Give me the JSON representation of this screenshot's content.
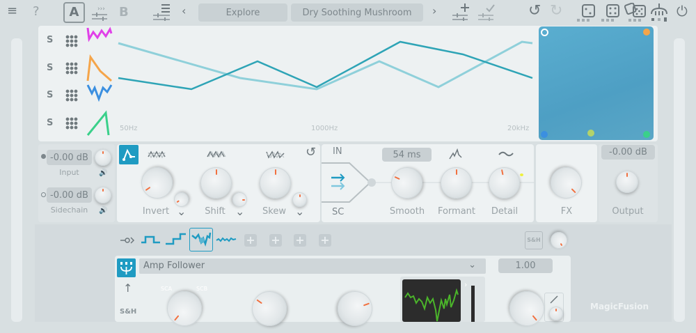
{
  "toolbar": {
    "menu": "≡",
    "help": "?",
    "a_label": "A",
    "b_label": "B",
    "prev": "‹",
    "next": "›",
    "preset_bank": "Explore",
    "preset_name": "Dry Soothing Mushroom",
    "undo": "↺",
    "redo": "↻",
    "power": "⏻"
  },
  "display": {
    "rows": [
      {
        "label": "S"
      },
      {
        "label": "S"
      },
      {
        "label": "S"
      },
      {
        "label": "S"
      }
    ],
    "freq_labels": [
      "50Hz",
      "1000Hz",
      "20kHz"
    ],
    "colors": {
      "light_line": "#8fd0da",
      "dark_line": "#2ea4b6",
      "xy_pad": "#5aaacb"
    }
  },
  "io": {
    "input_value": "-0.00 dB",
    "input_label": "Input",
    "sidechain_value": "-0.00 dB",
    "sidechain_label": "Sidechain",
    "speaker": "🔊"
  },
  "shape": {
    "knobs": [
      {
        "label": "Invert"
      },
      {
        "label": "Shift"
      },
      {
        "label": "Skew"
      }
    ],
    "chevron": "⌄",
    "reset": "↺"
  },
  "router": {
    "in_label": "IN",
    "sc_label": "SC",
    "smooth_value": "54 ms",
    "knobs": [
      {
        "label": "Smooth"
      },
      {
        "label": "Formant"
      },
      {
        "label": "Detail"
      }
    ]
  },
  "fx": {
    "label": "FX"
  },
  "output": {
    "value": "-0.00 dB",
    "label": "Output"
  },
  "mod": {
    "sh_button": "S&H",
    "plus": "+",
    "source": "Amp Follower",
    "source_chevron": "⌄",
    "amount": "1.00",
    "sca": "SCA",
    "scb": "SCB",
    "sh_label": "S&H",
    "arrow_up": "↑",
    "watermark": "MagicFusion"
  }
}
